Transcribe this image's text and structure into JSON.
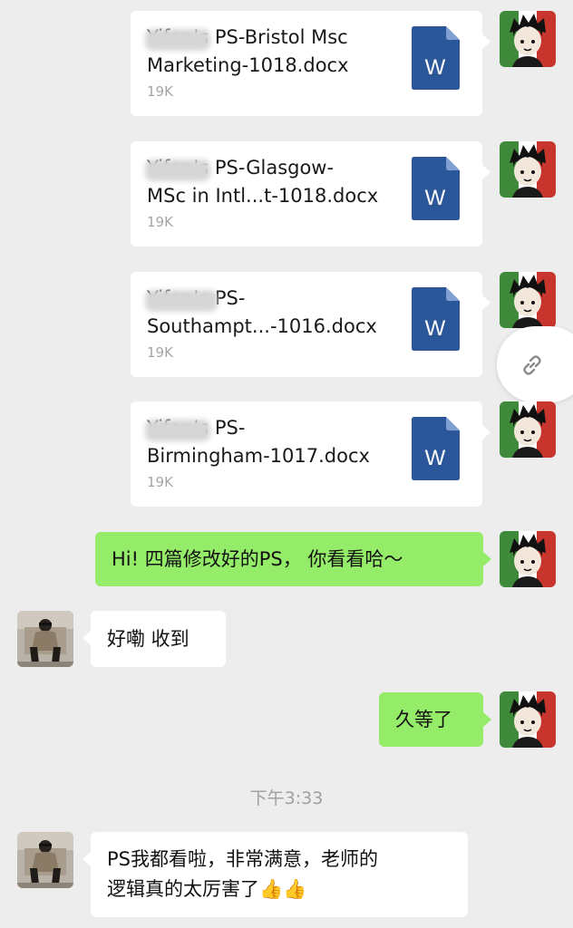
{
  "files": [
    {
      "name": "Yifan's PS-Bristol Msc\nMarketing-1018.docx",
      "size": "19K",
      "type_icon": "word-icon"
    },
    {
      "name": "Yifan's PS-Glasgow-\nMSc in Intl...t-1018.docx",
      "size": "19K",
      "type_icon": "word-icon"
    },
    {
      "name": "Yifan's PS-\nSouthampt...-1016.docx",
      "size": "19K",
      "type_icon": "word-icon"
    },
    {
      "name": "Yifan's PS-\nBirmingham-1017.docx",
      "size": "19K",
      "type_icon": "word-icon"
    }
  ],
  "messages": {
    "m1": "Hi! 四篇修改好的PS， 你看看哈～",
    "m2": "好嘞 收到",
    "m3": "久等了",
    "m4_line1": "PS我都看啦，非常满意，老师的",
    "m4_line2": "逻辑真的太厉害了",
    "m4_emoji": "👍👍"
  },
  "timestamp": "下午3:33",
  "word_letter": "W",
  "colors": {
    "bubble_green": "#95ec69",
    "background": "#ededed",
    "word_blue": "#2b579a"
  },
  "floating_button": "link-icon"
}
